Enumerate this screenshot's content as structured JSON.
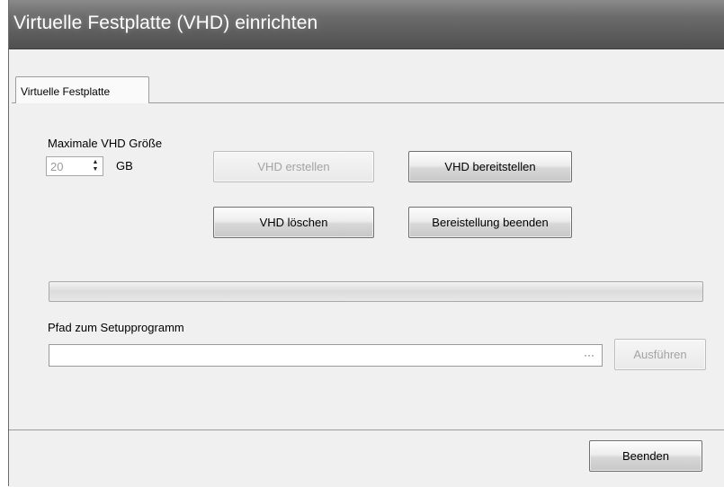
{
  "window": {
    "title": "Virtuelle Festplatte (VHD) einrichten"
  },
  "tabs": [
    {
      "label": "Virtuelle Festplatte"
    }
  ],
  "size": {
    "label": "Maximale VHD Größe",
    "value": "20",
    "unit": "GB"
  },
  "buttons": {
    "create": "VHD erstellen",
    "mount": "VHD bereitstellen",
    "delete": "VHD löschen",
    "unmount": "Bereistellung beenden",
    "run": "Ausführen",
    "exit": "Beenden"
  },
  "progress": {
    "value": 0
  },
  "setup": {
    "label": "Pfad zum Setupprogramm",
    "value": "",
    "browse": "···"
  }
}
